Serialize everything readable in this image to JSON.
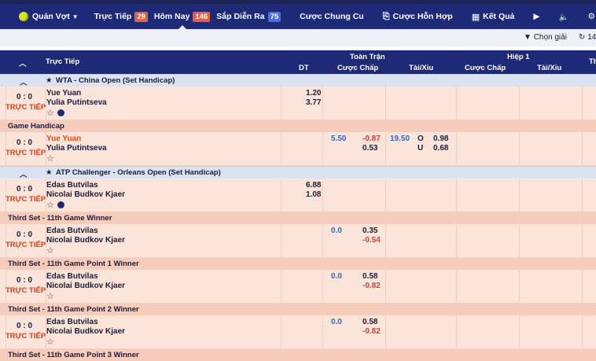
{
  "nav": {
    "sport": "Quản Vợt",
    "items": [
      {
        "label": "Trực Tiếp",
        "count": "29"
      },
      {
        "label": "Hôm Nay",
        "count": "146"
      },
      {
        "label": "Sắp Diễn Ra",
        "count": "75"
      },
      {
        "label": "Cược Chung Cu"
      },
      {
        "label": "Cược Hỗn Hợp"
      },
      {
        "label": "Kết Quả"
      }
    ],
    "active": "Hôm Nay",
    "colors": {
      "bar": "#1e2a78",
      "badge_red": "#e26044",
      "badge_blue": "#4a6fd8"
    }
  },
  "subbar": {
    "filter_label": "Chọn giải",
    "refresh_label": "14"
  },
  "table": {
    "col_live": "Trực Tiếp",
    "group_full": "Toàn Trận",
    "group_half": "Hiệp 1",
    "group_more": "Th",
    "cols": {
      "dt": "DT",
      "hdp": "Cược Chấp",
      "ou": "Tài/Xỉu",
      "hdp1": "Cược Chấp",
      "ou1": "Tài/Xỉu"
    }
  },
  "sections": [
    {
      "league": "WTA - China Open (Set Handicap)",
      "rows": [
        {
          "kind": "match",
          "score": "0 : 0",
          "live": "TRỰC TIẾP",
          "home": "Yue Yuan",
          "away": "Yulia Putintseva",
          "dt_home": "1.20",
          "dt_away": "3.77",
          "play": true
        },
        {
          "kind": "sub",
          "label": "Game Handicap"
        },
        {
          "kind": "match",
          "score": "0 : 0",
          "live": "TRỰC TIẾP",
          "home": "Yue Yuan",
          "away": "Yulia Putintseva",
          "home_red": true,
          "hdp_line": "5.50",
          "hdp_home": "-0.87",
          "hdp_away": "0.53",
          "ou_line": "19.50",
          "ou_o": "O",
          "ou_u": "U",
          "ou_over": "0.98",
          "ou_under": "0.68"
        }
      ]
    },
    {
      "league": "ATP Challenger - Orleans Open (Set Handicap)",
      "rows": [
        {
          "kind": "match",
          "score": "0 : 0",
          "live": "TRỰC TIẾP",
          "home": "Edas Butvilas",
          "away": "Nicolai Budkov Kjaer",
          "dt_home": "6.88",
          "dt_away": "1.08",
          "play": true
        },
        {
          "kind": "sub",
          "label": "Third Set - 11th Game Winner"
        },
        {
          "kind": "match",
          "score": "0 : 0",
          "live": "TRỰC TIẾP",
          "home": "Edas Butvilas",
          "away": "Nicolai Budkov Kjaer",
          "hdp_line": "0.0",
          "hdp_home": "0.35",
          "hdp_away": "-0.54"
        },
        {
          "kind": "sub",
          "label": "Third Set - 11th Game Point 1 Winner"
        },
        {
          "kind": "match",
          "score": "0 : 0",
          "live": "TRỰC TIẾP",
          "home": "Edas Butvilas",
          "away": "Nicolai Budkov Kjaer",
          "hdp_line": "0.0",
          "hdp_home": "0.58",
          "hdp_away": "-0.82"
        },
        {
          "kind": "sub",
          "label": "Third Set - 11th Game Point 2 Winner"
        },
        {
          "kind": "match",
          "score": "0 : 0",
          "live": "TRỰC TIẾP",
          "home": "Edas Butvilas",
          "away": "Nicolai Budkov Kjaer",
          "hdp_line": "0.0",
          "hdp_home": "0.58",
          "hdp_away": "-0.82"
        },
        {
          "kind": "sub",
          "label": "Third Set - 11th Game Point 3 Winner"
        }
      ]
    }
  ]
}
